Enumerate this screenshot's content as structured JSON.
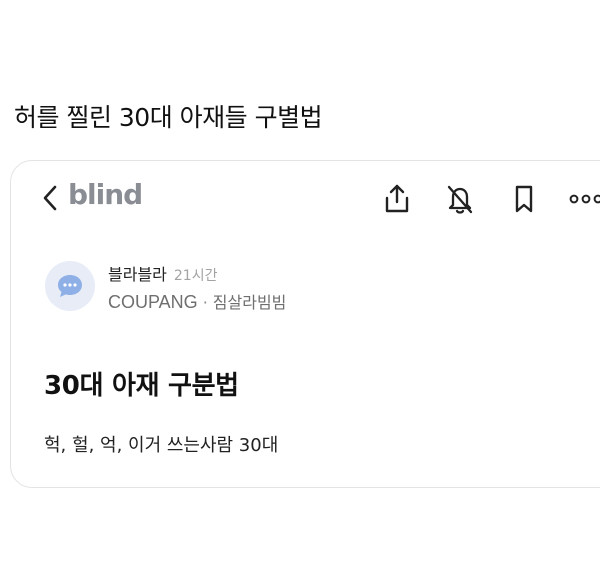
{
  "headline": "허를 찔린 30대 아재들 구별법",
  "app": {
    "brand": "blind",
    "nav_icons": [
      "chevron-left-icon",
      "share-icon",
      "bell-off-icon",
      "bookmark-icon",
      "more-icon"
    ]
  },
  "post": {
    "author_name": "블라블라",
    "time_ago": "21시간",
    "company": "COUPANG",
    "separator": "·",
    "nickname": "짐살라빔빔",
    "title": "30대 아재 구분법",
    "body": "헉, 헐, 억, 이거 쓰는사람 30대"
  },
  "colors": {
    "brand_gray": "#8a8d93",
    "avatar_bg": "#e7ecf7",
    "avatar_icon": "#8fb0e6"
  }
}
